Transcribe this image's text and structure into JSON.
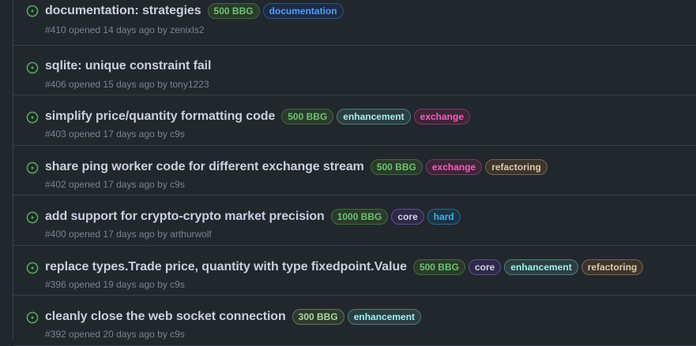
{
  "issues": [
    {
      "title": "documentation: strategies",
      "number": "#410",
      "opened_text": "opened 14 days ago by",
      "author": "zenixls2",
      "labels": [
        {
          "text": "500 BBG",
          "fg": "#6bc46d",
          "bg": "#2b3a2c",
          "border": "#3f6b40"
        },
        {
          "text": "documentation",
          "fg": "#539bf5",
          "bg": "#1c2c45",
          "border": "#2f5186"
        }
      ]
    },
    {
      "title": "sqlite: unique constraint fail",
      "number": "#406",
      "opened_text": "opened 15 days ago by",
      "author": "tony1223",
      "labels": []
    },
    {
      "title": "simplify price/quantity formatting code",
      "number": "#403",
      "opened_text": "opened 17 days ago by",
      "author": "c9s",
      "labels": [
        {
          "text": "500 BBG",
          "fg": "#6bc46d",
          "bg": "#2b3a2c",
          "border": "#3f6b40"
        },
        {
          "text": "enhancement",
          "fg": "#a2eeef",
          "bg": "#2c3e40",
          "border": "#4e7e80"
        },
        {
          "text": "exchange",
          "fg": "#f060c0",
          "bg": "#3d2637",
          "border": "#7a3a66"
        }
      ]
    },
    {
      "title": "share ping worker code for different exchange stream",
      "number": "#402",
      "opened_text": "opened 17 days ago by",
      "author": "c9s",
      "labels": [
        {
          "text": "500 BBG",
          "fg": "#6bc46d",
          "bg": "#2b3a2c",
          "border": "#3f6b40"
        },
        {
          "text": "exchange",
          "fg": "#f060c0",
          "bg": "#3d2637",
          "border": "#7a3a66"
        },
        {
          "text": "refactoring",
          "fg": "#e0c8a8",
          "bg": "#3b352e",
          "border": "#76654e"
        }
      ]
    },
    {
      "title": "add support for crypto-crypto market precision",
      "number": "#400",
      "opened_text": "opened 17 days ago by",
      "author": "arthurwolf",
      "labels": [
        {
          "text": "1000 BBG",
          "fg": "#6bc46d",
          "bg": "#2b3a2c",
          "border": "#3f6b40"
        },
        {
          "text": "core",
          "fg": "#d6ccf5",
          "bg": "#2e2a45",
          "border": "#5d4f9a"
        },
        {
          "text": "hard",
          "fg": "#3fb0e0",
          "bg": "#1a3445",
          "border": "#2a6788"
        }
      ]
    },
    {
      "title": "replace types.Trade price, quantity with type fixedpoint.Value",
      "number": "#396",
      "opened_text": "opened 19 days ago by",
      "author": "c9s",
      "labels": [
        {
          "text": "500 BBG",
          "fg": "#6bc46d",
          "bg": "#2b3a2c",
          "border": "#3f6b40"
        },
        {
          "text": "core",
          "fg": "#d6ccf5",
          "bg": "#2e2a45",
          "border": "#5d4f9a"
        },
        {
          "text": "enhancement",
          "fg": "#a2eeef",
          "bg": "#2c3e40",
          "border": "#4e7e80"
        },
        {
          "text": "refactoring",
          "fg": "#e0c8a8",
          "bg": "#3b352e",
          "border": "#76654e"
        }
      ]
    },
    {
      "title": "cleanly close the web socket connection",
      "number": "#392",
      "opened_text": "opened 20 days ago by",
      "author": "c9s",
      "labels": [
        {
          "text": "300 BBG",
          "fg": "#a8d8a0",
          "bg": "#2f3a2e",
          "border": "#5c7a56"
        },
        {
          "text": "enhancement",
          "fg": "#a2eeef",
          "bg": "#2c3e40",
          "border": "#4e7e80"
        }
      ]
    }
  ],
  "icon": "issue-opened-icon",
  "colors": {
    "open": "#57ab5a",
    "background": "#22272e",
    "border": "#373e47"
  }
}
